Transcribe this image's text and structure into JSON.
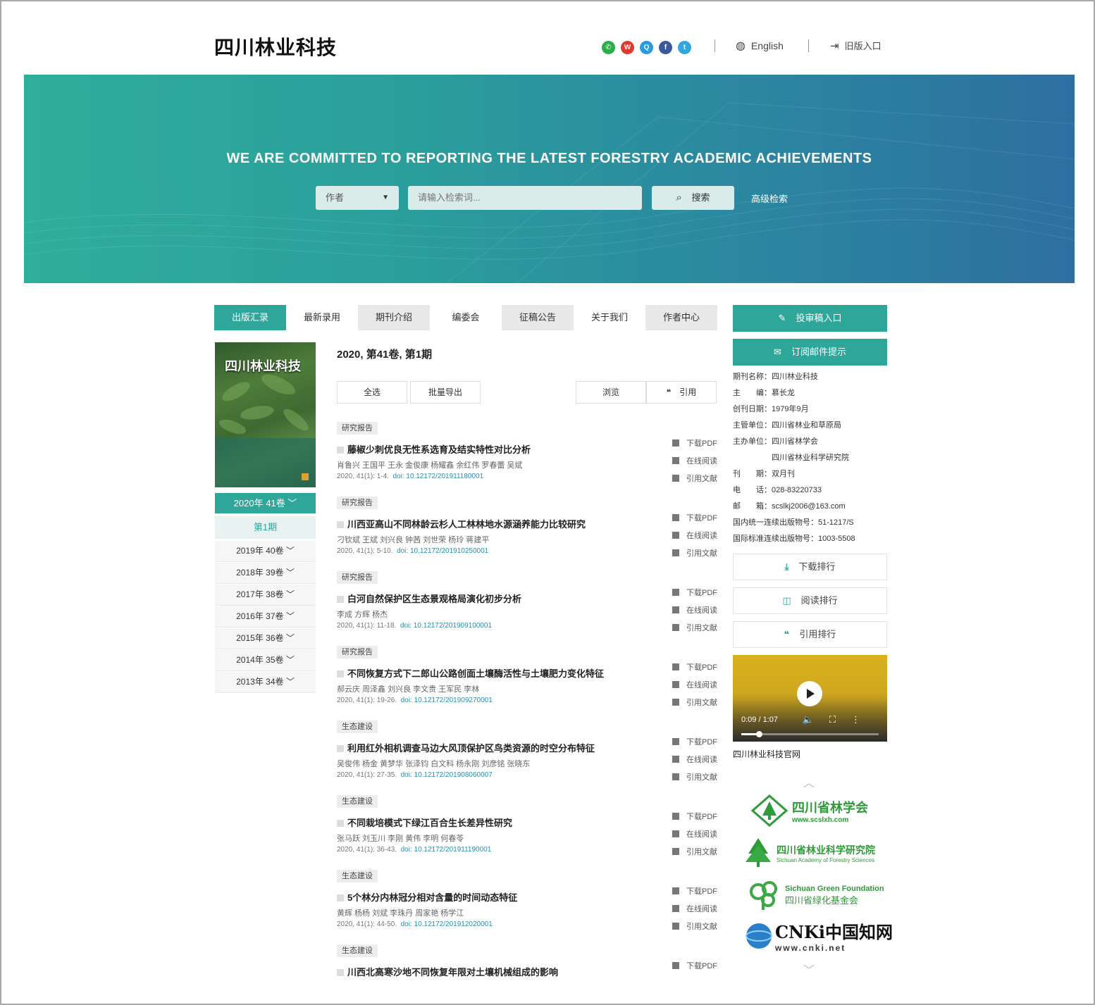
{
  "header": {
    "site_title": "四川林业科技",
    "social_icons": [
      {
        "name": "wechat-icon",
        "color": "#2aae48",
        "glyph": "✆"
      },
      {
        "name": "weibo-icon",
        "color": "#e0392f",
        "glyph": "W"
      },
      {
        "name": "qq-icon",
        "color": "#2a9be0",
        "glyph": "Q"
      },
      {
        "name": "facebook-icon",
        "color": "#3b5998",
        "glyph": "f"
      },
      {
        "name": "twitter-icon",
        "color": "#33a6de",
        "glyph": "t"
      }
    ],
    "language": "English",
    "login": "旧版入口"
  },
  "banner": {
    "slogan": "WE ARE COMMITTED TO REPORTING THE LATEST FORESTRY ACADEMIC ACHIEVEMENTS",
    "search_type": "作者",
    "search_placeholder": "请输入检索词...",
    "search_button": "搜索",
    "advanced_search": "高级检索"
  },
  "nav": {
    "tabs": [
      "出版汇录",
      "最新录用",
      "期刊介绍",
      "编委会",
      "征稿公告",
      "关于我们",
      "作者中心"
    ]
  },
  "left": {
    "cover_title": "四川林业科技",
    "current_year": "2020年 41卷",
    "current_issue": "第1期",
    "years": [
      "2019年 40卷",
      "2018年 39卷",
      "2017年 38卷",
      "2016年 37卷",
      "2015年 36卷",
      "2014年 35卷",
      "2013年 34卷"
    ]
  },
  "main": {
    "issue_title": "2020, 第41卷, 第1期",
    "tools": [
      "全选",
      "批量导出",
      "浏览",
      "引用"
    ],
    "actions": {
      "download": "下载PDF",
      "read": "在线阅读",
      "cite": "引用文献"
    },
    "articles": [
      {
        "category": "研究报告",
        "title": "藤椒少刺优良无性系选育及结实特性对比分析",
        "authors": "肖鲁兴 王国平 王永 金俊康 杨耀鑫 余红伟 罗春蕾 吴斌",
        "meta": "2020, 41(1): 1-4.",
        "doi": "doi: 10.12172/201911180001"
      },
      {
        "category": "研究报告",
        "title": "川西亚高山不同林龄云杉人工林林地水源涵养能力比较研究",
        "authors": "刁钦斌 王斌 刘兴良 钟茜 刘世荣 杨玲 蒋建平",
        "meta": "2020, 41(1): 5-10.",
        "doi": "doi: 10.12172/201910250001"
      },
      {
        "category": "研究报告",
        "title": "白河自然保护区生态景观格局演化初步分析",
        "authors": "李成 方辉 杨杰",
        "meta": "2020, 41(1): 11-18.",
        "doi": "doi: 10.12172/201909100001"
      },
      {
        "category": "研究报告",
        "title": "不同恢复方式下二郎山公路创面土壤酶活性与土壤肥力变化特征",
        "authors": "郝云庆 周泽鑫 刘兴良 李文贵 王军民 李林",
        "meta": "2020, 41(1): 19-26.",
        "doi": "doi: 10.12172/201909270001"
      },
      {
        "category": "生态建设",
        "title": "利用红外相机调查马边大风顶保护区鸟类资源的时空分布特征",
        "authors": "吴俊伟 杨金 黄梦华 张泽钧 白文科 杨永刚 刘彦铭 张晓东",
        "meta": "2020, 41(1): 27-35.",
        "doi": "doi: 10.12172/201908060007"
      },
      {
        "category": "生态建设",
        "title": "不同栽培模式下绿江百合生长差异性研究",
        "authors": "张马跃 刘玉川 李刚 黄伟 李明 何春苓",
        "meta": "2020, 41(1): 36-43.",
        "doi": "doi: 10.12172/201911190001"
      },
      {
        "category": "生态建设",
        "title": "5个林分内林冠分相对含量的时间动态特征",
        "authors": "黄辉 杨杨 刘斌 李珠丹 周家艳 杨学江",
        "meta": "2020, 41(1): 44-50.",
        "doi": "doi: 10.12172/201912020001"
      },
      {
        "category": "生态建设",
        "title": "川西北高寒沙地不同恢复年限对土壤机械组成的影响",
        "authors": "",
        "meta": "",
        "doi": ""
      }
    ]
  },
  "right": {
    "submit_button": "投审稿入口",
    "subscribe_button": "订阅邮件提示",
    "info": [
      "期刊名称：四川林业科技",
      "主　　编：慕长龙",
      "创刊日期：1979年9月",
      "主管单位：四川省林业和草原局",
      "主办单位：四川省林学会",
      "　　　　　四川省林业科学研究院",
      "刊　　期：双月刊",
      "电　　话：028-83220733",
      "邮　　箱：scslkj2006@163.com",
      "国内统一连续出版物号：51-1217/S",
      "国际标准连续出版物号：1003-5508"
    ],
    "rankings": [
      "下载排行",
      "阅读排行",
      "引用排行"
    ],
    "video": {
      "time": "0:09 / 1:07",
      "progress": 0.13,
      "caption": "四川林业科技官网"
    },
    "logos": {
      "society_name": "四川省林学会",
      "society_url": "www.scslxh.com",
      "academy_name": "四川省林业科学研究院",
      "academy_en": "Sichuan Academy of Forestry Sciences",
      "foundation_en": "Sichuan Green Foundation",
      "foundation_cn": "四川省绿化基金会",
      "cnki_mark": "CNKi中国知网",
      "cnki_url": "www.cnki.net"
    }
  }
}
